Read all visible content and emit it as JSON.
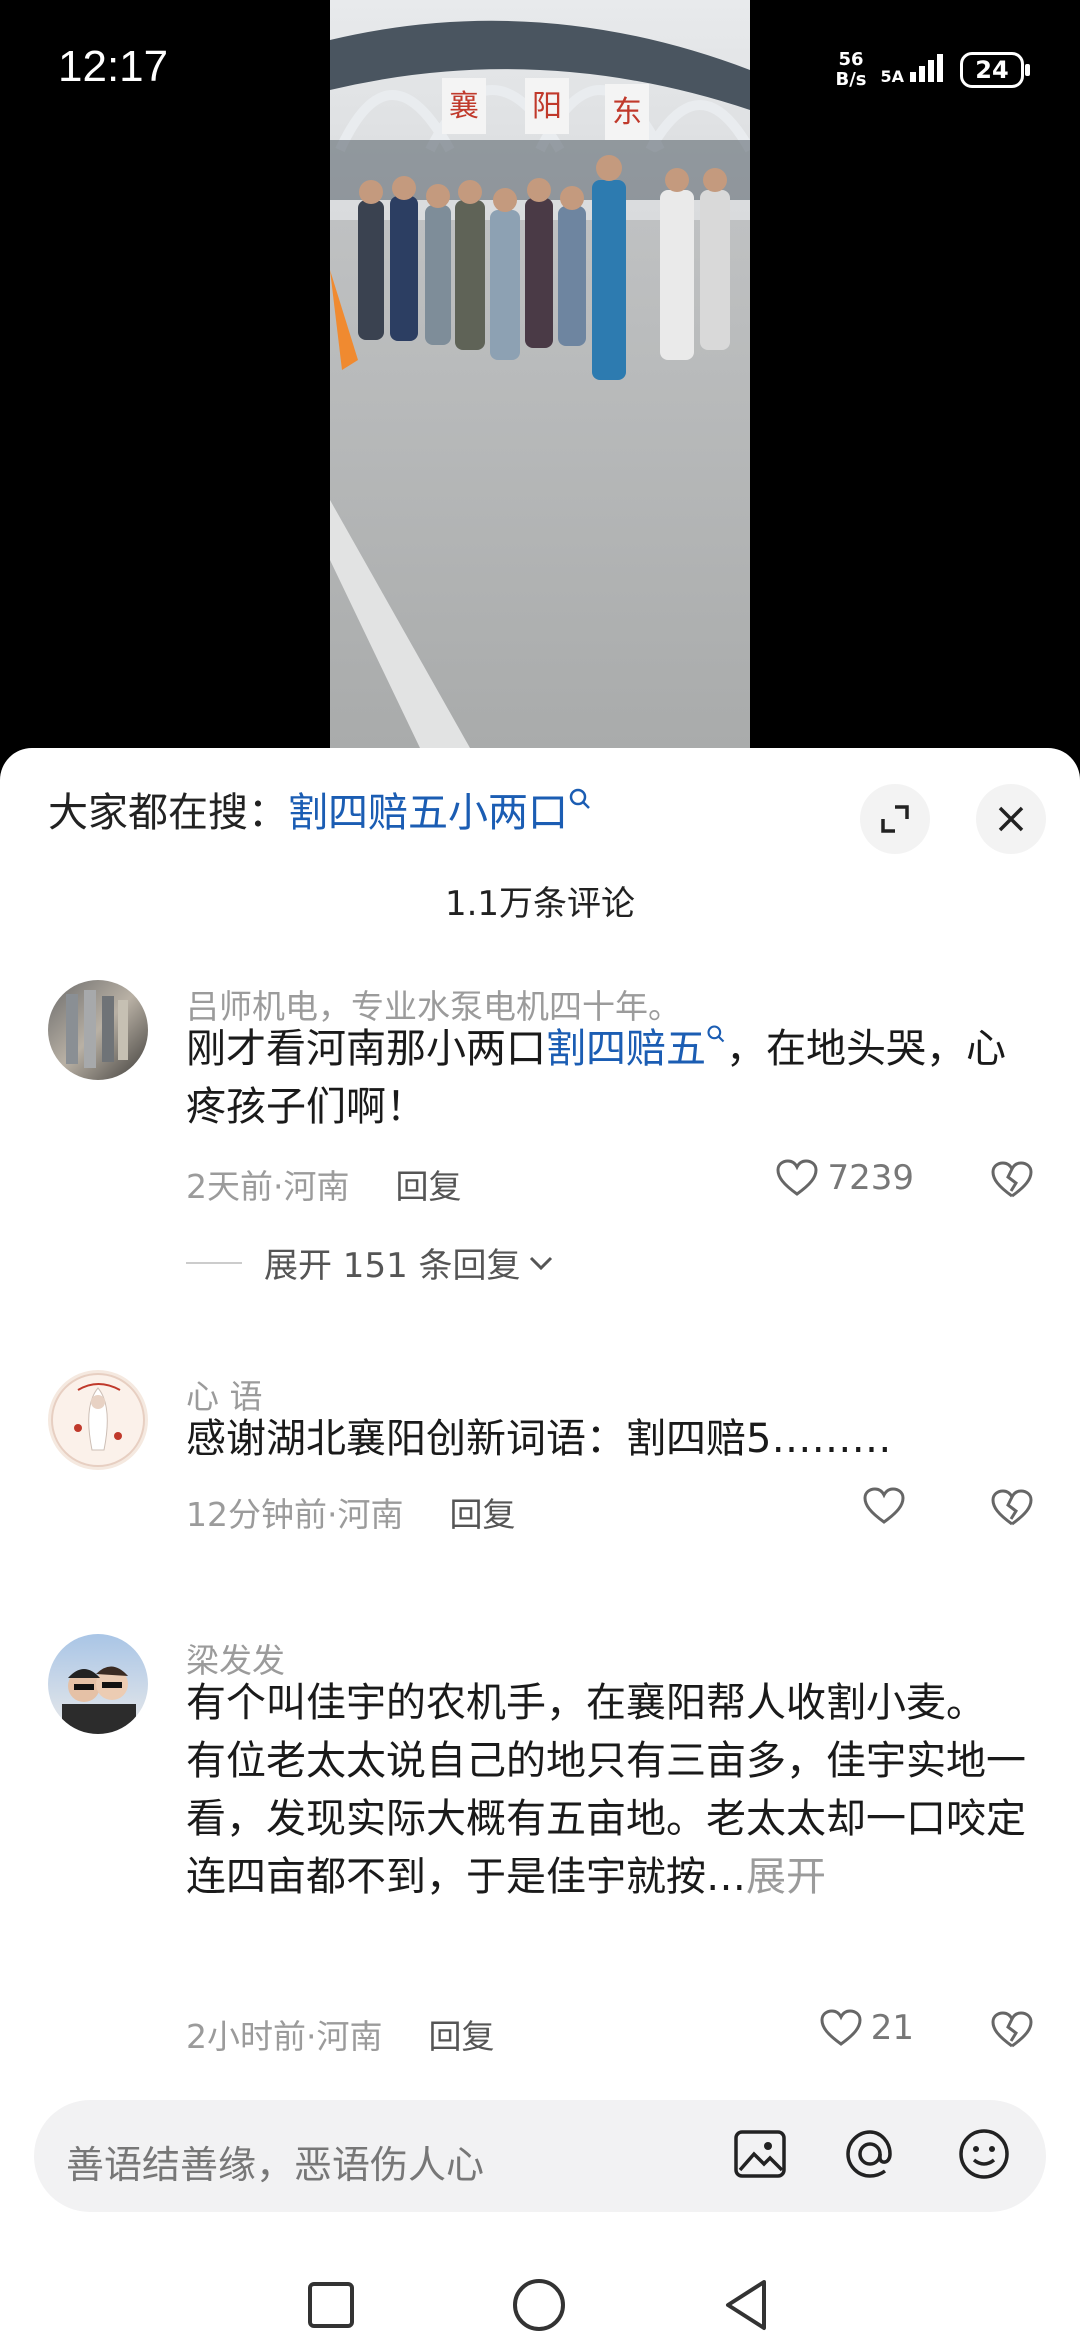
{
  "status_bar": {
    "time": "12:17",
    "net_speed_value": "56",
    "net_speed_unit": "B/s",
    "signal_label": "5A",
    "battery_level": "24"
  },
  "video": {
    "gate_sign_chars": [
      "襄",
      "阳",
      "东"
    ]
  },
  "search_header": {
    "prefix": "大家都在搜：",
    "term": "割四赔五小两口",
    "search_icon": "search-icon"
  },
  "comment_count": "1.1万条评论",
  "comments": [
    {
      "name": "吕师机电，专业水泵电机四十年。",
      "text_before": "刚才看河南那小两口",
      "link": "割四赔五",
      "text_after": "，在地头哭，心疼孩子们啊！",
      "time": "2天前·河南",
      "reply": "回复",
      "likes": "7239",
      "expand": "展开 151 条回复"
    },
    {
      "name": "心 语",
      "text": "感谢湖北襄阳创新词语：割四赔5………",
      "time": "12分钟前·河南",
      "reply": "回复",
      "likes": ""
    },
    {
      "name": "梁发发",
      "text": "有个叫佳宇的农机手，在襄阳帮人收割小麦。\n有位老太太说自己的地只有三亩多，佳宇实地一看，发现实际大概有五亩地。老太太却一口咬定连四亩都不到，于是佳宇就按…",
      "more": "展开",
      "time": "2小时前·河南",
      "reply": "回复",
      "likes": "21"
    }
  ],
  "input": {
    "placeholder": "善语结善缘，恶语伤人心"
  },
  "icons": [
    "expand-icon",
    "close-icon",
    "heart-icon",
    "dislike-icon",
    "image-icon",
    "at-icon",
    "emoji-icon",
    "chevron-down-icon",
    "square-nav-icon",
    "circle-nav-icon",
    "back-nav-icon"
  ],
  "colors": {
    "link": "#1b5db3",
    "muted": "#9b9b9b",
    "sheet": "#ffffff"
  }
}
